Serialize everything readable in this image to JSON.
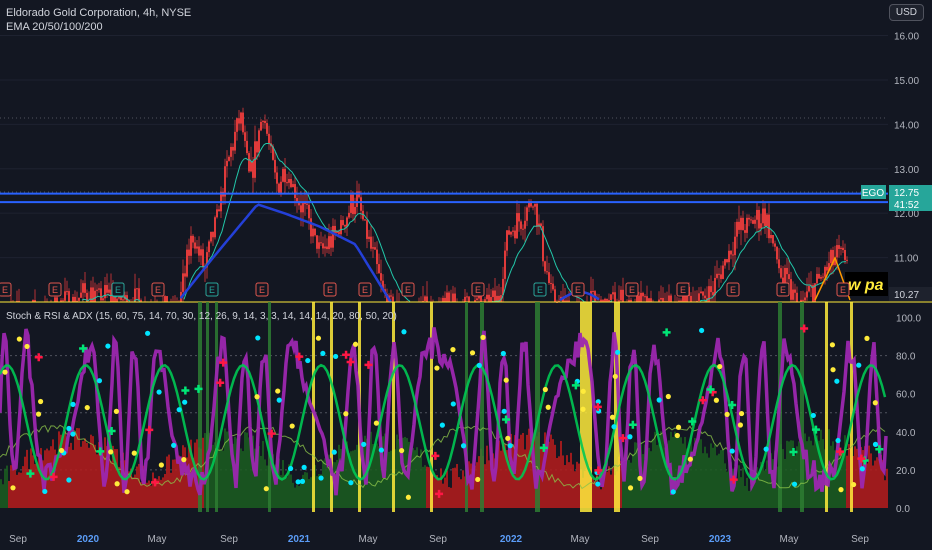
{
  "header": {
    "title": "Eldorado Gold Corporation, 4h, NYSE",
    "ema_label": "EMA 20/50/100/200",
    "indicator_label": "Stoch & RSI & ADX (15, 60, 75, 14, 70, 30, 12, 26, 9, 14, 3, 3, 14, 14, 14, 20, 80, 50, 20)",
    "currency": "USD"
  },
  "price_badge": {
    "ticker": "EGO",
    "price": "12.75",
    "countdown": "41:52"
  },
  "last_label": "10.27",
  "overlay_text": "w pa",
  "earnings_marker": "E",
  "colors": {
    "background": "#131722",
    "candle": "#e03a3a",
    "ema_fast": "#22c7a9",
    "ema_slow": "#2440d8",
    "hline": "#2962ff",
    "stoch": "#9c27b0",
    "adx": "#2e7d32",
    "red_hist": "#b71c1c",
    "yellow": "#ffeb3b",
    "cyan": "#00e5ff",
    "green_cross": "#00e676",
    "red_cross": "#ff1744",
    "badge": "#26a69a"
  },
  "chart_data": [
    {
      "type": "line",
      "title": "Eldorado Gold Corporation, 4h, NYSE",
      "ylim": [
        10,
        16.8
      ],
      "y_ticks": [
        11.0,
        12.0,
        13.0,
        14.0,
        15.0,
        16.0
      ],
      "x_ticks": [
        "Sep",
        "2020",
        "May",
        "Sep",
        "2021",
        "May",
        "Sep",
        "2022",
        "May",
        "Sep",
        "2023",
        "May",
        "Sep"
      ],
      "horizontal_lines": [
        12.44,
        12.25
      ],
      "series": [
        {
          "x": [
            0.0,
            0.05,
            0.1,
            0.15,
            0.2,
            0.215,
            0.23,
            0.26,
            0.27,
            0.28,
            0.295,
            0.31,
            0.32,
            0.34,
            0.36,
            0.38,
            0.4,
            0.43,
            0.44,
            0.45,
            0.48,
            0.52,
            0.56,
            0.57,
            0.6,
            0.62,
            0.64,
            0.66,
            0.7,
            0.74,
            0.8,
            0.83,
            0.86,
            0.88,
            0.9,
            0.94
          ],
          "values": [
            9.7,
            9.8,
            10.2,
            10.0,
            9.8,
            11.5,
            10.7,
            13.5,
            14.2,
            12.7,
            14.3,
            12.6,
            13.0,
            12.1,
            11.1,
            11.6,
            12.4,
            10.2,
            9.9,
            9.7,
            9.8,
            9.9,
            10.0,
            11.5,
            12.3,
            10.1,
            9.8,
            9.9,
            10.0,
            9.8,
            10.2,
            11.6,
            12.0,
            10.5,
            9.9,
            11.0
          ]
        },
        {
          "x": [
            0.2,
            0.24,
            0.29,
            0.32,
            0.36,
            0.4,
            0.44
          ],
          "values": [
            10.0,
            11.0,
            12.2,
            12.0,
            11.7,
            11.3,
            10.0
          ]
        }
      ]
    },
    {
      "type": "line",
      "title": "Stoch & RSI & ADX (15, 60, 75, 14, 70, 30, 12, 26, 9, 14, 3, 3, 14, 14, 14, 20, 80, 50, 20)",
      "ylim": [
        0,
        105
      ],
      "y_ticks": [
        0.0,
        20.0,
        40.0,
        60.0,
        80.0,
        100.0
      ],
      "reference_levels": [
        20,
        50,
        80
      ]
    }
  ]
}
